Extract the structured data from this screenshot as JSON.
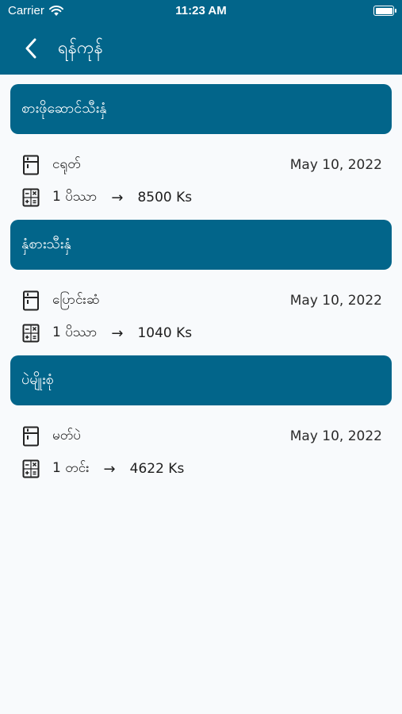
{
  "status": {
    "carrier": "Carrier",
    "time": "11:23 AM"
  },
  "nav": {
    "title": "ရန်ကုန်"
  },
  "sections": [
    {
      "header": "စားဖိုဆောင်သီးနှံ",
      "item_name": "ငရုတ်",
      "date": "May 10, 2022",
      "quantity": "1 ပိဿာ",
      "arrow": "→",
      "price": "8500 Ks"
    },
    {
      "header": "နှံစားသီးနှံ",
      "item_name": "ပြောင်းဆံ",
      "date": "May 10, 2022",
      "quantity": "1 ပိဿာ",
      "arrow": "→",
      "price": "1040 Ks"
    },
    {
      "header": "ပဲမျိုးစုံ",
      "item_name": "မတ်ပဲ",
      "date": "May 10, 2022",
      "quantity": "1 တင်း",
      "arrow": "→",
      "price": "4622 Ks"
    }
  ]
}
